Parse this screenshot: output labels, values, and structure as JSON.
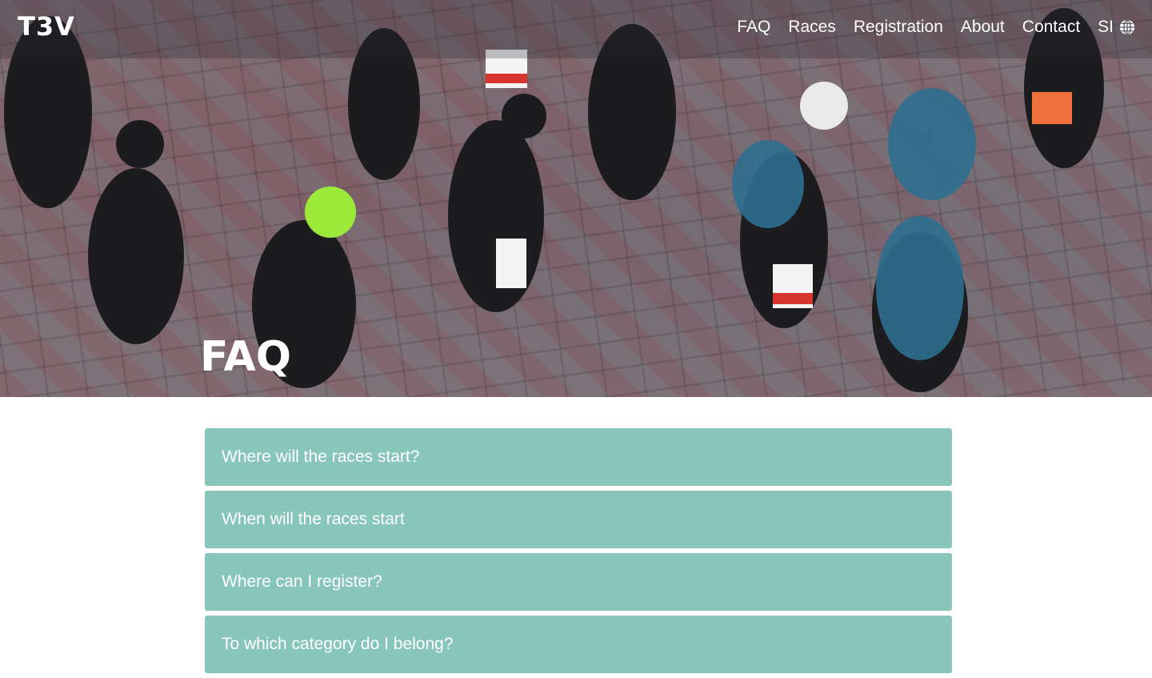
{
  "brand": {
    "logo": "T3V"
  },
  "nav": {
    "items": [
      "FAQ",
      "Races",
      "Registration",
      "About",
      "Contact"
    ],
    "language": "SI",
    "language_icon": "globe-icon"
  },
  "hero": {
    "title": "FAQ"
  },
  "faq": {
    "items": [
      "Where will the races start?",
      "When will the races start",
      "Where can I register?",
      "To which category do I belong?"
    ]
  },
  "colors": {
    "accordion": "#88c5ba",
    "text_light": "#ffffff"
  }
}
